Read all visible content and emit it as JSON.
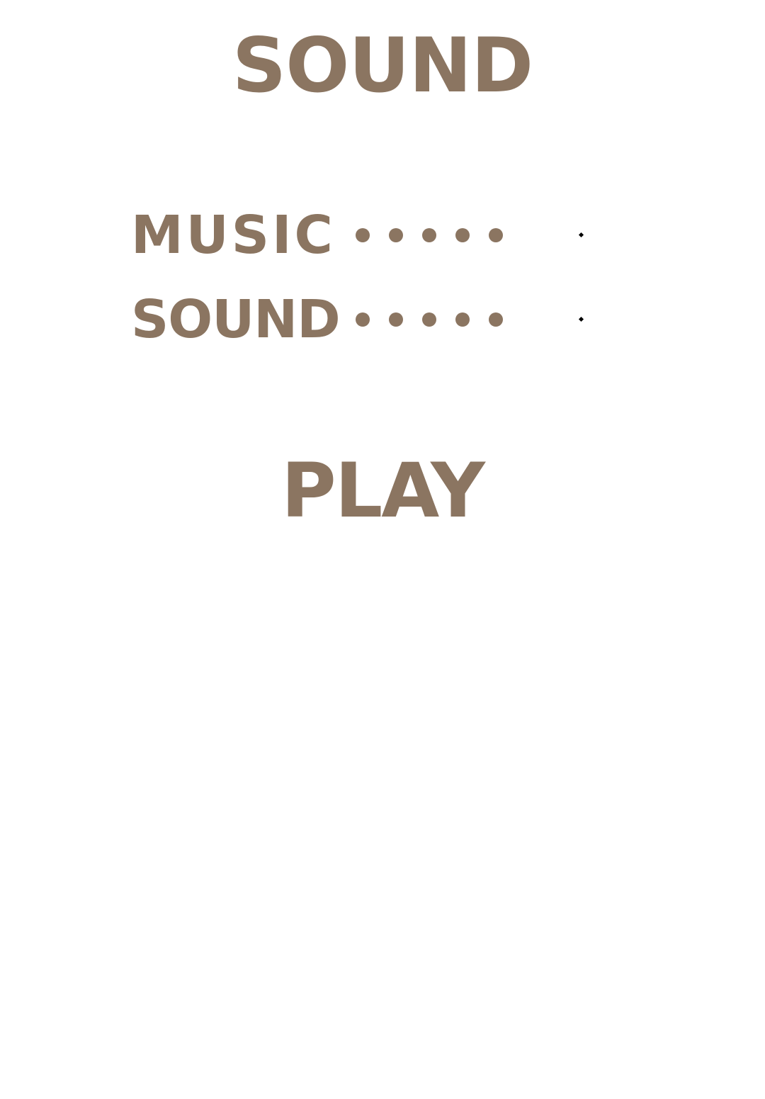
{
  "title": "SOUND",
  "settings": [
    {
      "label": "MUSIC",
      "level_dots": 5
    },
    {
      "label": "SOUND",
      "level_dots": 5
    }
  ],
  "play_label": "PLAY",
  "colors": {
    "text": "#8b7561",
    "background": "#ffffff",
    "marker": "#000000"
  }
}
